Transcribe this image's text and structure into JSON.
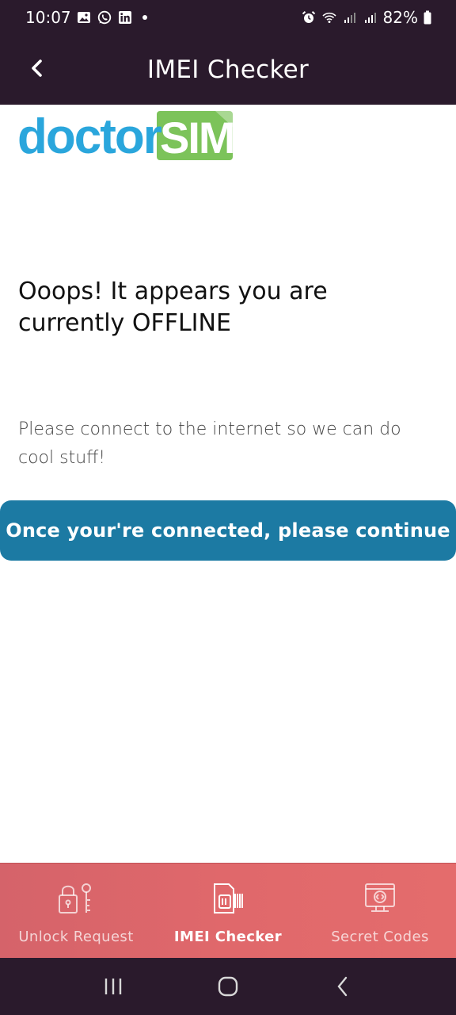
{
  "status_bar": {
    "time": "10:07",
    "battery": "82%",
    "icons_left": [
      "image-icon",
      "whatsapp-icon",
      "linkedin-icon",
      "dot-icon"
    ],
    "icons_right": [
      "alarm-icon",
      "wifi-icon",
      "signal-icon",
      "signal-icon",
      "battery-icon"
    ]
  },
  "app_bar": {
    "title": "IMEI Checker",
    "back_icon": "chevron-left-icon"
  },
  "logo": {
    "part1": "doctor",
    "part2": "SIM",
    "colors": {
      "doctor": "#2aa6dc",
      "sim_bg": "#7cc35a"
    }
  },
  "content": {
    "headline": "Ooops! It appears you are currently OFFLINE",
    "subtext": "Please connect to the internet so we can do cool stuff!",
    "button_label": "Once your're connected, please continue"
  },
  "bottom_nav": {
    "items": [
      {
        "label": "Unlock Request",
        "icon": "lock-key-icon",
        "active": false
      },
      {
        "label": "IMEI Checker",
        "icon": "sim-barcode-icon",
        "active": true
      },
      {
        "label": "Secret Codes",
        "icon": "code-monitor-icon",
        "active": false
      }
    ]
  },
  "colors": {
    "app_bar": "#2a1a2c",
    "button": "#1c7aa3",
    "bottom_nav": "#e0686b"
  }
}
